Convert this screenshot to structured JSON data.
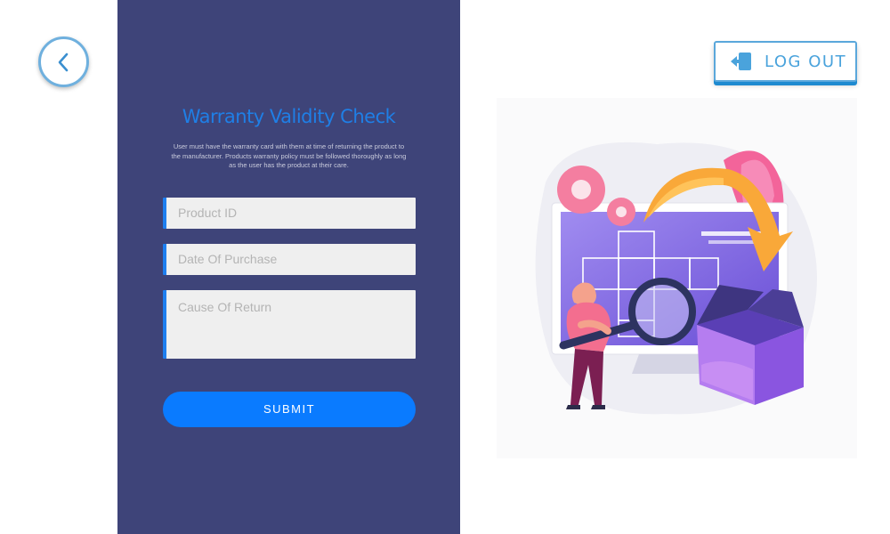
{
  "header": {
    "back_icon": "chevron-left-icon",
    "logout_label": "LOG OUT",
    "logout_icon": "logout-icon"
  },
  "form": {
    "title": "Warranty Validity Check",
    "description": "User must have the warranty card with them at time of returning the product to the manufacturer. Products warranty policy must be followed thoroughly as long as the user has the product at their care.",
    "product_id_placeholder": "Product ID",
    "date_placeholder": "Date Of Purchase",
    "cause_placeholder": "Cause Of Return",
    "submit_label": "SUBMIT"
  },
  "colors": {
    "panel": "#3e4479",
    "accent": "#0a7bff",
    "title": "#1f7fe6",
    "logout": "#4aa3dc"
  }
}
